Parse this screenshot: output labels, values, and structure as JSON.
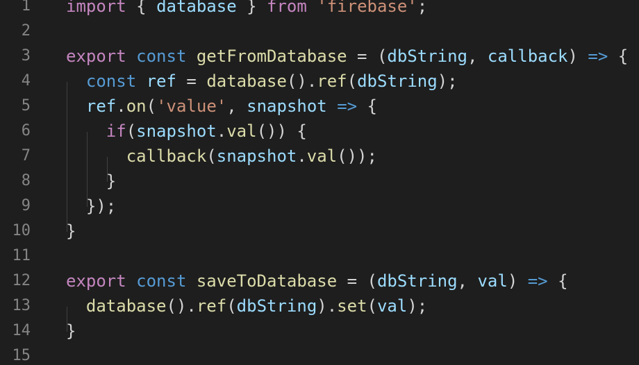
{
  "editor": {
    "language": "javascript",
    "colors": {
      "background": "#1e1e1e",
      "line_number": "#858585",
      "keyword_control": "#c586c0",
      "keyword_storage": "#569cd6",
      "variable": "#9cdcfe",
      "function": "#dcdcaa",
      "string": "#ce9178",
      "punctuation": "#d4d4d4"
    },
    "lines": [
      {
        "number": "1",
        "tokens": [
          {
            "t": "import",
            "c": "kw"
          },
          {
            "t": " { ",
            "c": "pun"
          },
          {
            "t": "database",
            "c": "var"
          },
          {
            "t": " } ",
            "c": "pun"
          },
          {
            "t": "from",
            "c": "kw"
          },
          {
            "t": " ",
            "c": "pun"
          },
          {
            "t": "'firebase'",
            "c": "str"
          },
          {
            "t": ";",
            "c": "pun"
          }
        ]
      },
      {
        "number": "2",
        "tokens": []
      },
      {
        "number": "3",
        "tokens": [
          {
            "t": "export",
            "c": "kw"
          },
          {
            "t": " ",
            "c": "pun"
          },
          {
            "t": "const",
            "c": "st"
          },
          {
            "t": " ",
            "c": "pun"
          },
          {
            "t": "getFromDatabase",
            "c": "fn"
          },
          {
            "t": " = (",
            "c": "pun"
          },
          {
            "t": "dbString",
            "c": "var"
          },
          {
            "t": ", ",
            "c": "pun"
          },
          {
            "t": "callback",
            "c": "var"
          },
          {
            "t": ") ",
            "c": "pun"
          },
          {
            "t": "=>",
            "c": "arr"
          },
          {
            "t": " {",
            "c": "pun"
          }
        ]
      },
      {
        "number": "4",
        "tokens": [
          {
            "t": "  ",
            "c": "pun"
          },
          {
            "t": "const",
            "c": "st"
          },
          {
            "t": " ",
            "c": "pun"
          },
          {
            "t": "ref",
            "c": "var"
          },
          {
            "t": " = ",
            "c": "pun"
          },
          {
            "t": "database",
            "c": "fn"
          },
          {
            "t": "().",
            "c": "pun"
          },
          {
            "t": "ref",
            "c": "fn"
          },
          {
            "t": "(",
            "c": "pun"
          },
          {
            "t": "dbString",
            "c": "var"
          },
          {
            "t": ");",
            "c": "pun"
          }
        ]
      },
      {
        "number": "5",
        "tokens": [
          {
            "t": "  ",
            "c": "pun"
          },
          {
            "t": "ref",
            "c": "var"
          },
          {
            "t": ".",
            "c": "pun"
          },
          {
            "t": "on",
            "c": "fn"
          },
          {
            "t": "(",
            "c": "pun"
          },
          {
            "t": "'value'",
            "c": "str"
          },
          {
            "t": ", ",
            "c": "pun"
          },
          {
            "t": "snapshot",
            "c": "var"
          },
          {
            "t": " ",
            "c": "pun"
          },
          {
            "t": "=>",
            "c": "arr"
          },
          {
            "t": " {",
            "c": "pun"
          }
        ]
      },
      {
        "number": "6",
        "tokens": [
          {
            "t": "    ",
            "c": "pun"
          },
          {
            "t": "if",
            "c": "kw"
          },
          {
            "t": "(",
            "c": "pun"
          },
          {
            "t": "snapshot",
            "c": "var"
          },
          {
            "t": ".",
            "c": "pun"
          },
          {
            "t": "val",
            "c": "fn"
          },
          {
            "t": "()) {",
            "c": "pun"
          }
        ]
      },
      {
        "number": "7",
        "tokens": [
          {
            "t": "      ",
            "c": "pun"
          },
          {
            "t": "callback",
            "c": "fn"
          },
          {
            "t": "(",
            "c": "pun"
          },
          {
            "t": "snapshot",
            "c": "var"
          },
          {
            "t": ".",
            "c": "pun"
          },
          {
            "t": "val",
            "c": "fn"
          },
          {
            "t": "());",
            "c": "pun"
          }
        ]
      },
      {
        "number": "8",
        "tokens": [
          {
            "t": "    }",
            "c": "pun"
          }
        ]
      },
      {
        "number": "9",
        "tokens": [
          {
            "t": "  });",
            "c": "pun"
          }
        ]
      },
      {
        "number": "10",
        "tokens": [
          {
            "t": "}",
            "c": "pun"
          }
        ]
      },
      {
        "number": "11",
        "tokens": []
      },
      {
        "number": "12",
        "tokens": [
          {
            "t": "export",
            "c": "kw"
          },
          {
            "t": " ",
            "c": "pun"
          },
          {
            "t": "const",
            "c": "st"
          },
          {
            "t": " ",
            "c": "pun"
          },
          {
            "t": "saveToDatabase",
            "c": "fn"
          },
          {
            "t": " = (",
            "c": "pun"
          },
          {
            "t": "dbString",
            "c": "var"
          },
          {
            "t": ", ",
            "c": "pun"
          },
          {
            "t": "val",
            "c": "var"
          },
          {
            "t": ") ",
            "c": "pun"
          },
          {
            "t": "=>",
            "c": "arr"
          },
          {
            "t": " {",
            "c": "pun"
          }
        ]
      },
      {
        "number": "13",
        "tokens": [
          {
            "t": "  ",
            "c": "pun"
          },
          {
            "t": "database",
            "c": "fn"
          },
          {
            "t": "().",
            "c": "pun"
          },
          {
            "t": "ref",
            "c": "fn"
          },
          {
            "t": "(",
            "c": "pun"
          },
          {
            "t": "dbString",
            "c": "var"
          },
          {
            "t": ").",
            "c": "pun"
          },
          {
            "t": "set",
            "c": "fn"
          },
          {
            "t": "(",
            "c": "pun"
          },
          {
            "t": "val",
            "c": "var"
          },
          {
            "t": ");",
            "c": "pun"
          }
        ]
      },
      {
        "number": "14",
        "tokens": [
          {
            "t": "}",
            "c": "pun"
          }
        ]
      },
      {
        "number": "15",
        "tokens": []
      }
    ]
  }
}
